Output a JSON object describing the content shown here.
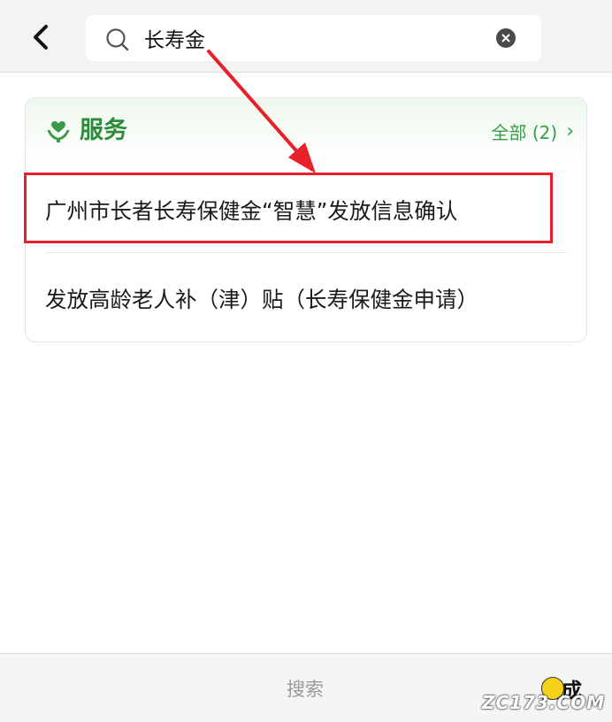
{
  "search": {
    "query": "长寿金",
    "placeholder": ""
  },
  "services": {
    "title": "服务",
    "view_all_label": "全部 (2)",
    "items": [
      {
        "label": "广州市长者长寿保健金“智慧”发放信息确认"
      },
      {
        "label": "发放高龄老人补（津）贴（长寿保健金申请）"
      }
    ]
  },
  "bottom_bar": {
    "search_label": "搜索",
    "done_label": "完成"
  },
  "watermark": {
    "text": "ZC173.COM"
  },
  "colors": {
    "accent_green": "#2e8b3a",
    "highlight_red": "#e8202a"
  }
}
